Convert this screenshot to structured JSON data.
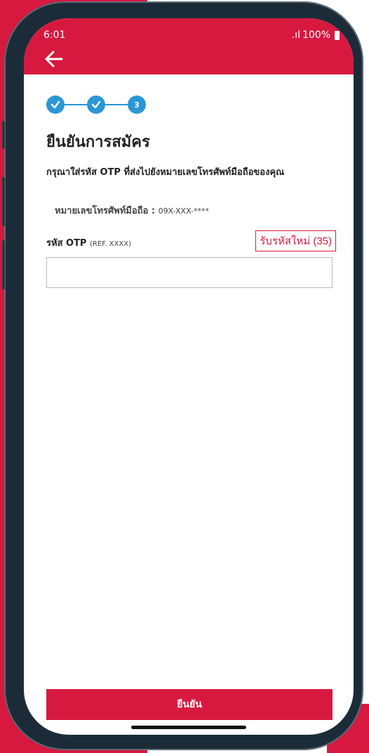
{
  "status_bar": {
    "time": "6:01",
    "signal": ".ıl",
    "battery": "100%"
  },
  "stepper": {
    "step3_label": "3"
  },
  "page": {
    "title": "ยืนยันการสมัคร",
    "subtitle": "กรุณาใส่รหัส OTP ที่ส่งไปยังหมายเลขโทรศัพท์มือถือของคุณ"
  },
  "phone": {
    "label": "หมายเลขโทรศัพท์มือถือ :",
    "number": "09X-XXX-****"
  },
  "otp": {
    "label": "รหัส OTP",
    "ref": "(REF. XXXX)",
    "value": "",
    "placeholder": ""
  },
  "resend": {
    "label": "รับรหัสใหม่ (35)"
  },
  "confirm": {
    "label": "ยืนยัน"
  },
  "colors": {
    "brand_red": "#d7193f",
    "step_blue": "#2b96d6"
  }
}
